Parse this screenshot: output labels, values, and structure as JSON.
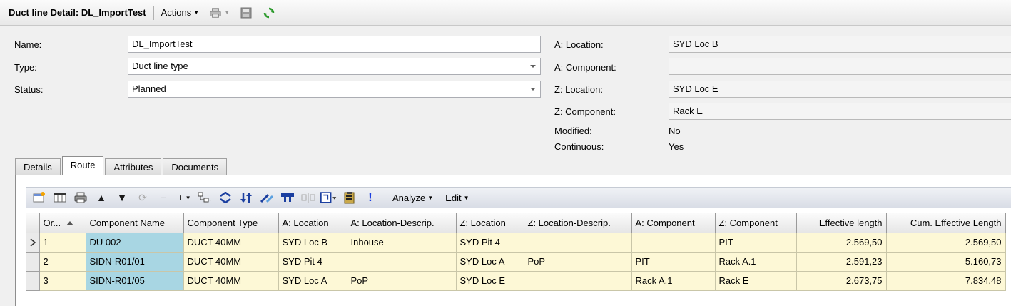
{
  "window": {
    "title": "Duct line Detail: DL_ImportTest",
    "actions_label": "Actions"
  },
  "form": {
    "name_label": "Name:",
    "name_value": "DL_ImportTest",
    "type_label": "Type:",
    "type_value": "Duct line type",
    "status_label": "Status:",
    "status_value": "Planned",
    "a_location_label": "A: Location:",
    "a_location_value": "SYD Loc B",
    "a_component_label": "A: Component:",
    "a_component_value": "",
    "z_location_label": "Z: Location:",
    "z_location_value": "SYD Loc E",
    "z_component_label": "Z: Component:",
    "z_component_value": "Rack E",
    "modified_label": "Modified:",
    "modified_value": "No",
    "continuous_label": "Continuous:",
    "continuous_value": "Yes"
  },
  "tabs": [
    {
      "label": "Details"
    },
    {
      "label": "Route",
      "active": true
    },
    {
      "label": "Attributes"
    },
    {
      "label": "Documents"
    }
  ],
  "route_toolbar": {
    "analyze_label": "Analyze",
    "edit_label": "Edit",
    "icons": [
      "new-row-icon",
      "columns-icon",
      "print-icon",
      "move-up-icon",
      "move-down-icon",
      "refresh-icon",
      "remove-icon",
      "add-icon",
      "structure-icon",
      "swap-icon",
      "sort-icon",
      "edit-route-icon",
      "connector-icon",
      "split-icon",
      "select-icon",
      "clipboard-icon",
      "alert-icon"
    ]
  },
  "grid": {
    "columns": [
      "Or...",
      "Component Name",
      "Component Type",
      "A: Location",
      "A: Location-Descrip.",
      "Z: Location",
      "Z: Location-Descrip.",
      "A: Component",
      "Z: Component",
      "Effective length",
      "Cum. Effective Length"
    ],
    "rows": [
      {
        "order": "1",
        "component_name": "DU 002",
        "component_type": "DUCT 40MM",
        "a_location": "SYD Loc B",
        "a_location_desc": "Inhouse",
        "z_location": "SYD Pit 4",
        "z_location_desc": "",
        "a_component": "",
        "z_component": "PIT",
        "effective_length": "2.569,50",
        "cum_effective_length": "2.569,50"
      },
      {
        "order": "2",
        "component_name": "SIDN-R01/01",
        "component_type": "DUCT 40MM",
        "a_location": "SYD Pit 4",
        "a_location_desc": "",
        "z_location": "SYD Loc A",
        "z_location_desc": "PoP",
        "a_component": "PIT",
        "z_component": "Rack A.1",
        "effective_length": "2.591,23",
        "cum_effective_length": "5.160,73"
      },
      {
        "order": "3",
        "component_name": "SIDN-R01/05",
        "component_type": "DUCT 40MM",
        "a_location": "SYD Loc A",
        "a_location_desc": "PoP",
        "z_location": "SYD Loc E",
        "z_location_desc": "",
        "a_component": "Rack A.1",
        "z_component": "Rack E",
        "effective_length": "2.673,75",
        "cum_effective_length": "7.834,48"
      }
    ]
  }
}
